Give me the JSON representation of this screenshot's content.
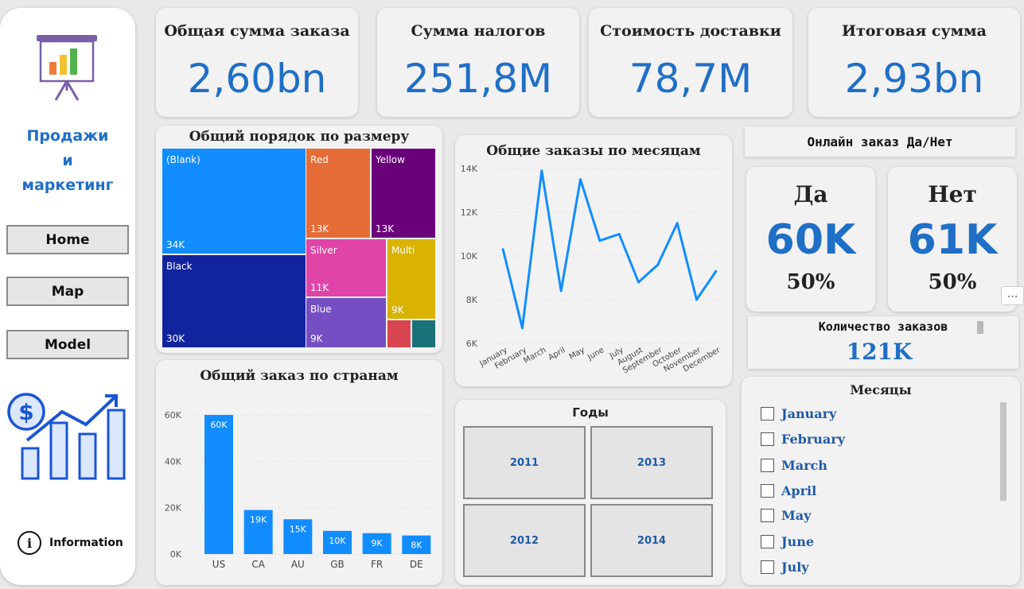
{
  "sidebar": {
    "title_lines": [
      "Продажи",
      "и",
      "маркетинг"
    ],
    "nav": [
      "Home",
      "Map",
      "Model"
    ],
    "info_label": "Information"
  },
  "kpis": [
    {
      "label": "Общая сумма заказа",
      "value": "2,60bn"
    },
    {
      "label": "Сумма налогов",
      "value": "251,8M"
    },
    {
      "label": "Стоимость доставки",
      "value": "78,7M"
    },
    {
      "label": "Итоговая сумма",
      "value": "2,93bn"
    }
  ],
  "online": {
    "title": "Онлайн заказ Да/Нет",
    "yes": {
      "label": "Да",
      "value": "60K",
      "percent": "50%"
    },
    "no": {
      "label": "Нет",
      "value": "61K",
      "percent": "50%"
    }
  },
  "orders_count": {
    "label": "Количество заказов",
    "value": "121K"
  },
  "years": {
    "title": "Годы",
    "items": [
      "2011",
      "2013",
      "2012",
      "2014"
    ]
  },
  "months": {
    "title": "Месяцы",
    "items": [
      "January",
      "February",
      "March",
      "April",
      "May",
      "June",
      "July"
    ]
  },
  "chart_data": [
    {
      "type": "treemap",
      "title": "Общий порядок по размеру",
      "items": [
        {
          "name": "(Blank)",
          "label": "34K",
          "value": 34,
          "color": "#118dff"
        },
        {
          "name": "Black",
          "label": "30K",
          "value": 30,
          "color": "#12239e"
        },
        {
          "name": "Red",
          "label": "13K",
          "value": 13,
          "color": "#e66c37"
        },
        {
          "name": "Yellow",
          "label": "13K",
          "value": 13,
          "color": "#6b007b"
        },
        {
          "name": "Silver",
          "label": "11K",
          "value": 11,
          "color": "#e044a7"
        },
        {
          "name": "Multi",
          "label": "9K",
          "value": 9,
          "color": "#d9b300"
        },
        {
          "name": "Blue",
          "label": "9K",
          "value": 9,
          "color": "#744ec2"
        },
        {
          "name": "",
          "label": "",
          "value": 2,
          "color": "#d64550"
        },
        {
          "name": "",
          "label": "",
          "value": 2,
          "color": "#197278"
        }
      ]
    },
    {
      "type": "line",
      "title": "Общие заказы по месяцам",
      "categories": [
        "January",
        "February",
        "March",
        "April",
        "May",
        "June",
        "July",
        "August",
        "September",
        "October",
        "November",
        "December"
      ],
      "values": [
        10300,
        6700,
        13900,
        8400,
        13500,
        10700,
        11000,
        8800,
        9600,
        11500,
        8000,
        9300
      ],
      "ylim": [
        6000,
        14000
      ],
      "yticks": [
        6000,
        8000,
        10000,
        12000,
        14000
      ],
      "ytick_labels": [
        "6K",
        "8K",
        "10K",
        "12K",
        "14K"
      ],
      "color": "#118dff"
    },
    {
      "type": "bar",
      "title": "Общий заказ по странам",
      "categories": [
        "US",
        "CA",
        "AU",
        "GB",
        "FR",
        "DE"
      ],
      "values": [
        60000,
        19000,
        15000,
        10000,
        9000,
        8000
      ],
      "labels": [
        "60K",
        "19K",
        "15K",
        "10K",
        "9K",
        "8K"
      ],
      "ylim": [
        0,
        60000
      ],
      "yticks": [
        0,
        20000,
        40000,
        60000
      ],
      "ytick_labels": [
        "0K",
        "20K",
        "40K",
        "60K"
      ],
      "color": "#118dff"
    }
  ]
}
